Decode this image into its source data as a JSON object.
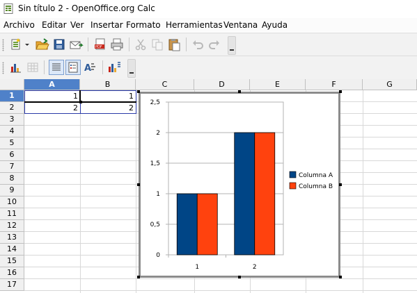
{
  "window": {
    "title": "Sin título 2 - OpenOffice.org Calc"
  },
  "menu": [
    "Archivo",
    "Editar",
    "Ver",
    "Insertar",
    "Formato",
    "Herramientas",
    "Ventana",
    "Ayuda"
  ],
  "toolbar_standard": {
    "icons": [
      "new-icon",
      "dropdown-arrow-icon",
      "open-icon",
      "save-icon",
      "email-icon",
      "export-pdf-icon",
      "print-icon",
      "cut-icon",
      "copy-icon",
      "paste-icon",
      "undo-icon",
      "redo-icon",
      "toolbar-overflow-icon"
    ]
  },
  "toolbar_chart": {
    "icons": [
      "chart-type-icon",
      "data-table-icon",
      "horizontal-grid-icon",
      "legend-toggle-icon",
      "scale-text-icon",
      "auto-layout-icon",
      "toolbar-overflow-icon"
    ]
  },
  "sheet": {
    "columns": [
      "A",
      "B",
      "C",
      "D",
      "E",
      "F",
      "G"
    ],
    "rows": [
      "1",
      "2",
      "3",
      "4",
      "5",
      "6",
      "7",
      "8",
      "9",
      "10",
      "11",
      "12",
      "13",
      "14",
      "15",
      "16",
      "17"
    ],
    "cells": {
      "A1": "1",
      "B1": "1",
      "A2": "2",
      "B2": "2"
    },
    "selected_cell": "A1"
  },
  "colors": {
    "series_a": "#004586",
    "series_b": "#ff420e",
    "selection": "#4f81c9"
  },
  "chart_data": {
    "type": "bar",
    "categories": [
      "1",
      "2"
    ],
    "series": [
      {
        "name": "Columna A",
        "values": [
          1,
          2
        ],
        "color": "#004586"
      },
      {
        "name": "Columna B",
        "values": [
          1,
          2
        ],
        "color": "#ff420e"
      }
    ],
    "ylim": [
      0,
      2.5
    ],
    "yticks": [
      "0",
      "0,5",
      "1",
      "1,5",
      "2",
      "2,5"
    ],
    "grid": true,
    "legend": "right"
  }
}
